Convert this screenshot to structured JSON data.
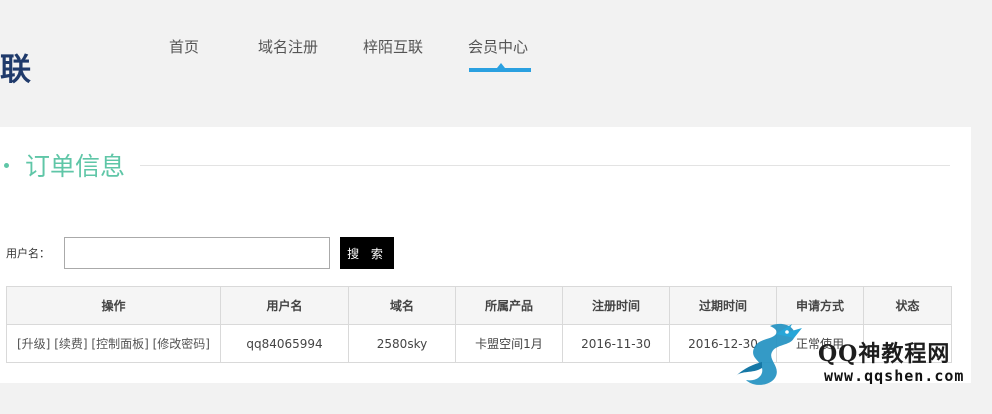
{
  "brand": {
    "logo_fragment": "联"
  },
  "nav": {
    "items": [
      {
        "label": "首页"
      },
      {
        "label": "域名注册"
      },
      {
        "label": "梓陌互联"
      },
      {
        "label": "会员中心"
      }
    ],
    "active_index": 3
  },
  "section": {
    "title": "订单信息"
  },
  "search": {
    "label": "用户名：",
    "input_value": "",
    "input_placeholder": "",
    "button_label": "搜 索"
  },
  "table": {
    "headers": [
      "操作",
      "用户名",
      "域名",
      "所属产品",
      "注册时间",
      "过期时间",
      "申请方式",
      "状态"
    ],
    "rows": [
      {
        "actions": [
          "[升级]",
          "[续费]",
          "[控制面板]",
          "[修改密码]"
        ],
        "username": "qq84065994",
        "domain": "2580sky",
        "product": "卡盟空间1月",
        "reg_date": "2016-11-30",
        "exp_date": "2016-12-30",
        "method": "正常使用",
        "status": ""
      }
    ]
  },
  "watermark": {
    "title": "QQ神教程网",
    "url": "www.qqshen.com"
  },
  "colors": {
    "accent_green": "#5fc6a7",
    "nav_active": "#2aa0e0",
    "logo_blue": "#1f3a6b",
    "button_bg": "#000000"
  }
}
